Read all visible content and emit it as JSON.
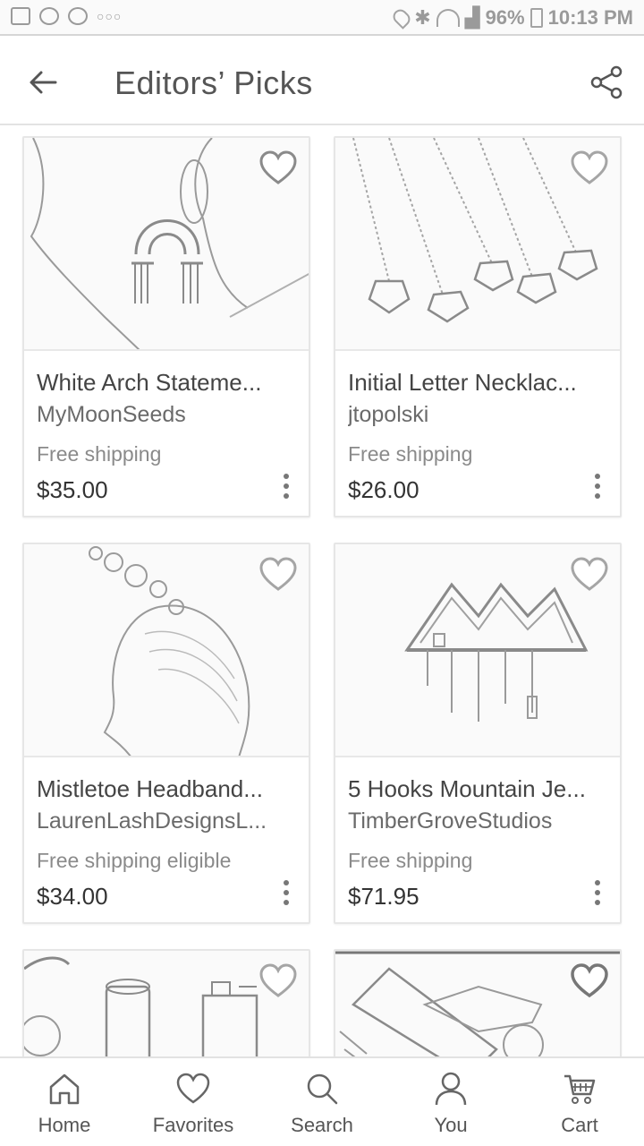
{
  "status_bar": {
    "battery": "96%",
    "time": "10:13 PM"
  },
  "header": {
    "title": "Editors’ Picks",
    "back_icon": "arrow-left-icon",
    "share_icon": "share-icon"
  },
  "listings": [
    {
      "name": "White Arch Stateme...",
      "shop": "MyMoonSeeds",
      "shipping": "Free shipping",
      "price": "$35.00",
      "image": "earring-arch-image"
    },
    {
      "name": "Initial Letter Necklac...",
      "shop": "jtopolski",
      "shipping": "Free shipping",
      "price": "$26.00",
      "image": "letter-necklaces-image"
    },
    {
      "name": "Mistletoe Headband...",
      "shop": "LaurenLashDesignsL...",
      "shipping": "Free shipping eligible",
      "price": "$34.00",
      "image": "headband-image"
    },
    {
      "name": "5 Hooks Mountain Je...",
      "shop": "TimberGroveStudios",
      "shipping": "Free shipping",
      "price": "$71.95",
      "image": "mountain-shelf-image"
    },
    {
      "name": "",
      "shop": "",
      "shipping": "",
      "price": "",
      "image": "candles-image"
    },
    {
      "name": "",
      "shop": "",
      "shipping": "",
      "price": "",
      "image": "pouch-image"
    }
  ],
  "nav": [
    {
      "label": "Home",
      "icon": "home-icon"
    },
    {
      "label": "Favorites",
      "icon": "heart-icon"
    },
    {
      "label": "Search",
      "icon": "search-icon"
    },
    {
      "label": "You",
      "icon": "user-icon"
    },
    {
      "label": "Cart",
      "icon": "cart-icon"
    }
  ]
}
